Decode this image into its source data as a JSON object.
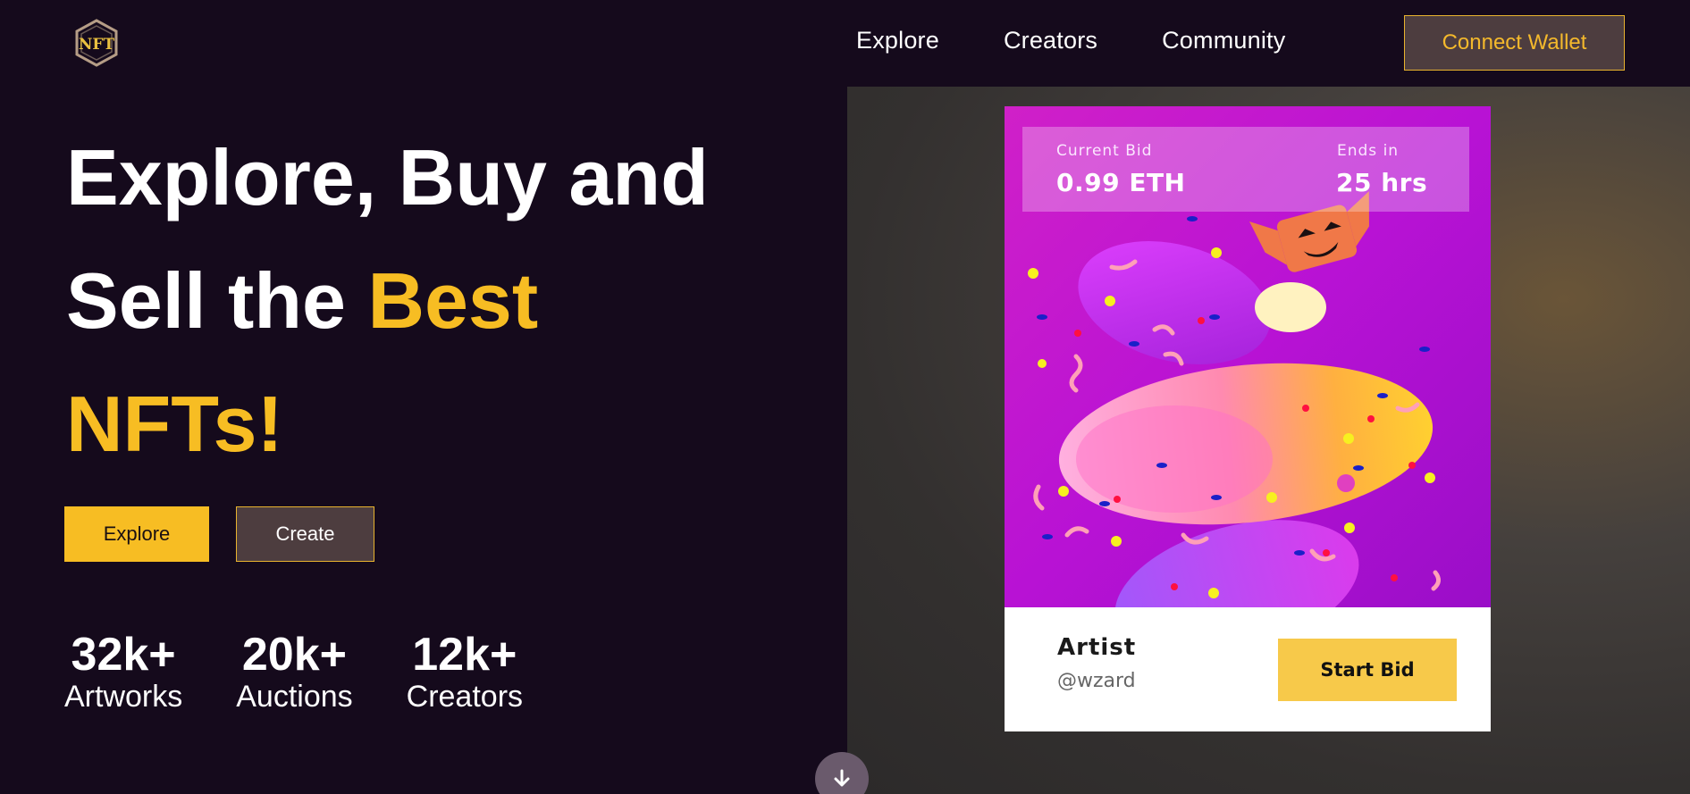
{
  "brand": {
    "logo_icon": "nft-hexagon-logo-icon",
    "logo_text": "NFT"
  },
  "nav": {
    "items": [
      {
        "label": "Explore"
      },
      {
        "label": "Creators"
      },
      {
        "label": "Community"
      }
    ]
  },
  "header": {
    "connect_label": "Connect Wallet"
  },
  "hero": {
    "line1": "Explore, Buy and",
    "line2_plain": "Sell the ",
    "line2_accent": "Best",
    "line3_accent": "NFTs!",
    "explore_label": "Explore",
    "create_label": "Create"
  },
  "stats": [
    {
      "value": "32k+",
      "label": "Artworks"
    },
    {
      "value": "20k+",
      "label": "Auctions"
    },
    {
      "value": "12k+",
      "label": "Creators"
    }
  ],
  "card": {
    "current_bid_label": "Current Bid",
    "current_bid_value": "0.99 ETH",
    "ends_label": "Ends in",
    "ends_value": "25 hrs",
    "artist_label": "Artist",
    "artist_handle": "@wzard",
    "start_bid_label": "Start Bid"
  },
  "scroll": {
    "icon": "arrow-down-icon"
  },
  "colors": {
    "background": "#150a1c",
    "accent": "#f7bd23",
    "button_dark": "#4d3d3f",
    "card_art_bg": "#c01ad0"
  }
}
